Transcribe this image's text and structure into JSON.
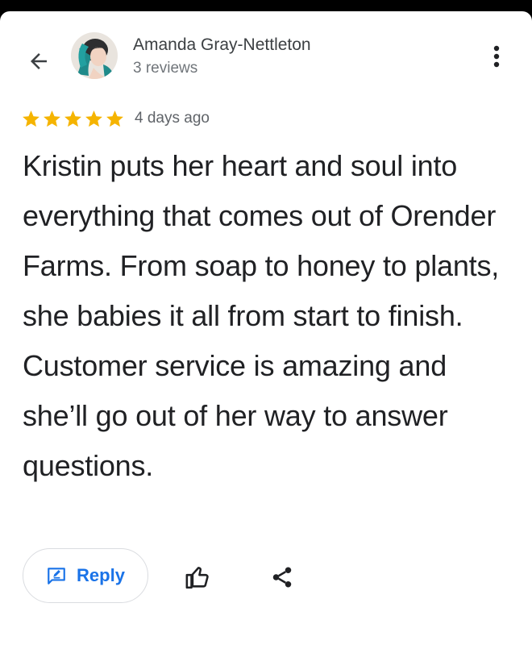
{
  "author": {
    "name": "Amanda Gray-Nettleton",
    "meta": "3 reviews"
  },
  "review": {
    "rating": 5,
    "max_rating": 5,
    "date": "4 days ago",
    "text": "Kristin puts her heart and soul into everything that comes out of Orender Farms. From soap to honey to plants, she babies it all from start to finish. Customer service is amazing and she’ll go out of her way to answer questions."
  },
  "actions": {
    "reply_label": "Reply"
  },
  "icons": {
    "back": "arrow-left-icon",
    "more": "more-vertical-icon",
    "star": "star-icon",
    "reply": "reply-edit-icon",
    "like": "thumbs-up-icon",
    "share": "share-icon"
  },
  "colors": {
    "star": "#f5b400",
    "accent": "#1a73e8",
    "text": "#202124",
    "secondary": "#70757a"
  }
}
